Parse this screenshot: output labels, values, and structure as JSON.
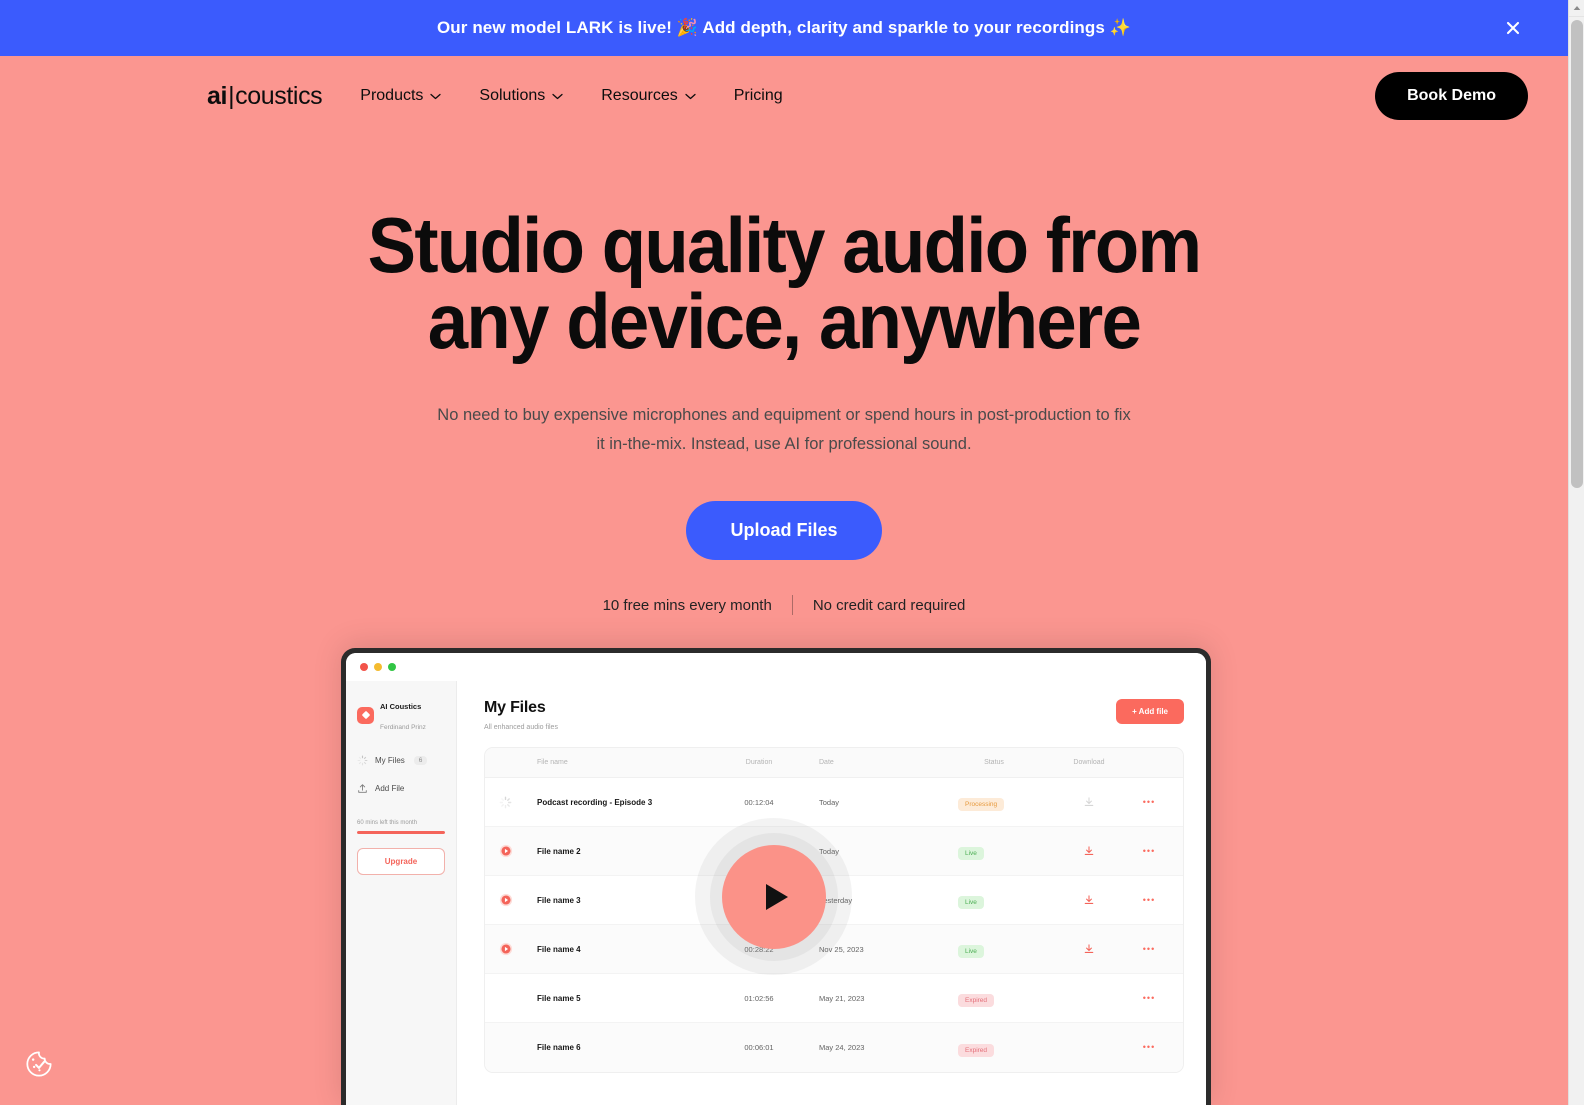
{
  "banner": {
    "text": "Our new model LARK is live! 🎉  Add depth, clarity and sparkle to your recordings ✨",
    "close_label": "close-banner",
    "bg": "#3B5BFD"
  },
  "nav": {
    "logo_bold": "ai",
    "logo_bar": "|",
    "logo_rest": "coustics",
    "links": [
      {
        "label": "Products",
        "has_chevron": true
      },
      {
        "label": "Solutions",
        "has_chevron": true
      },
      {
        "label": "Resources",
        "has_chevron": true
      },
      {
        "label": "Pricing",
        "has_chevron": false
      }
    ],
    "cta": "Book Demo"
  },
  "hero": {
    "title_line1": "Studio quality audio from",
    "title_line2": "any device, anywhere",
    "subtitle": "No need to buy expensive microphones and equipment or spend hours in post-production to fix it in-the-mix. Instead, use AI for professional sound.",
    "cta": "Upload Files",
    "meta_left": "10 free mins every month",
    "meta_right": "No credit card required",
    "bg": "#FB9690",
    "accent": "#3B5BFD"
  },
  "app": {
    "sidebar": {
      "account_name": "AI Coustics",
      "account_user": "Ferdinand Prinz",
      "nav": [
        {
          "label": "My Files",
          "count": "6",
          "icon": "spinner-icon"
        },
        {
          "label": "Add File",
          "count": "",
          "icon": "upload-icon"
        }
      ],
      "quota_text": "60 mins left this month",
      "quota_percent": 100,
      "upgrade": "Upgrade"
    },
    "main": {
      "title": "My Files",
      "subtitle": "All enhanced audio files",
      "add_file": "+ Add file",
      "columns": [
        "File name",
        "Duration",
        "Date",
        "Status",
        "Download"
      ],
      "rows": [
        {
          "name": "Podcast recording - Episode 3",
          "duration": "00:12:04",
          "date": "Today",
          "status": "Processing",
          "status_kind": "processing",
          "icon": "spinner-icon",
          "download": false
        },
        {
          "name": "File name 2",
          "duration": "",
          "date": "Today",
          "status": "Live",
          "status_kind": "live",
          "icon": "play-icon",
          "download": true
        },
        {
          "name": "File name 3",
          "duration": "",
          "date": "Yesterday",
          "status": "Live",
          "status_kind": "live",
          "icon": "play-icon",
          "download": true
        },
        {
          "name": "File name 4",
          "duration": "00:28:22",
          "date": "Nov 25, 2023",
          "status": "Live",
          "status_kind": "live",
          "icon": "play-icon",
          "download": true
        },
        {
          "name": "File name 5",
          "duration": "01:02:56",
          "date": "May 21, 2023",
          "status": "Expired",
          "status_kind": "expired",
          "icon": "",
          "download": false
        },
        {
          "name": "File name 6",
          "duration": "00:06:01",
          "date": "May 24, 2023",
          "status": "Expired",
          "status_kind": "expired",
          "icon": "",
          "download": false
        }
      ],
      "row_menu": "•••"
    },
    "play_button": "play-button"
  },
  "cookie_widget": "cookie-consent-icon"
}
